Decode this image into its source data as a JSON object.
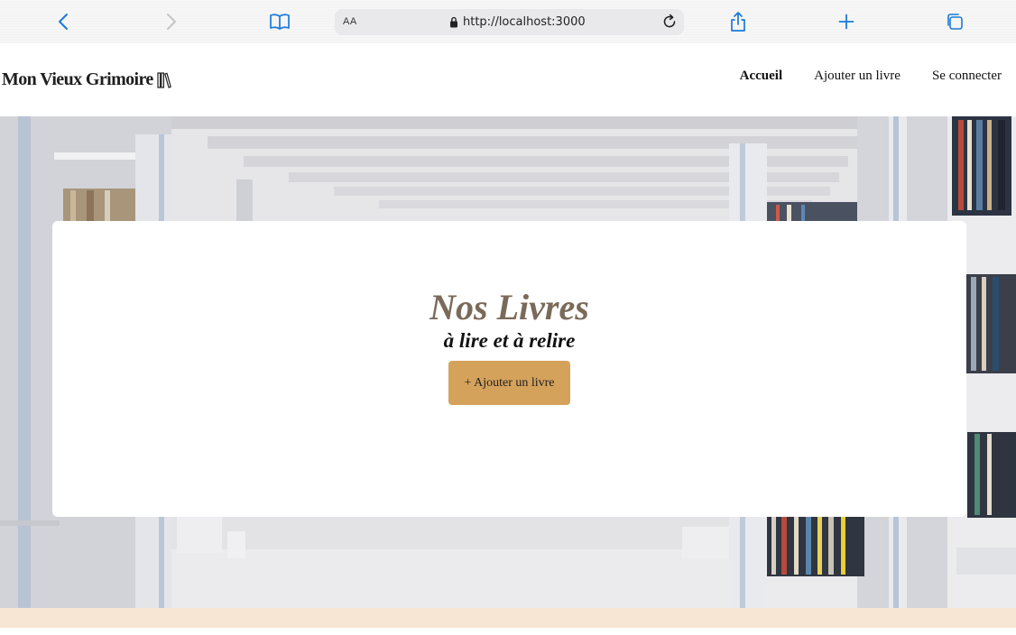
{
  "browser": {
    "text_size_label": "AA",
    "url": "http://localhost:3000",
    "accent_color": "#1a7ad9",
    "icons": [
      "back-icon",
      "forward-icon",
      "bookmarks-icon",
      "lock-icon",
      "reload-icon",
      "share-icon",
      "new-tab-icon",
      "tabs-icon"
    ]
  },
  "header": {
    "logo_text": "Mon Vieux Grimoire",
    "nav": [
      {
        "label": "Accueil",
        "active": true
      },
      {
        "label": "Ajouter un livre",
        "active": false
      },
      {
        "label": "Se connecter",
        "active": false
      }
    ]
  },
  "hero": {
    "title": "Nos Livres",
    "subtitle": "à lire et à relire",
    "button_label": "+ Ajouter un livre",
    "button_color": "#d5a25b",
    "title_color": "#7a6a5a"
  },
  "footer": {
    "strip_color": "#f6e6d3"
  }
}
